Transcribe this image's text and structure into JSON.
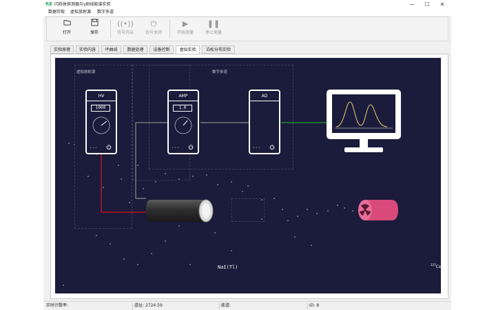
{
  "window": {
    "title": "闪烁体探测器与γ射线能谱实验",
    "app_icon": "RE",
    "controls": {
      "minimize": "—",
      "maximize": "☐",
      "close": "✕"
    }
  },
  "menu": [
    "数据存取",
    "虚拟放射源",
    "数字多道"
  ],
  "toolbar": [
    {
      "label": "打开",
      "icon": "folder-open-icon",
      "enabled": true
    },
    {
      "label": "保存",
      "icon": "save-icon",
      "enabled": true
    },
    {
      "label": "信号开启",
      "icon": "signal-icon",
      "enabled": false
    },
    {
      "label": "信号关闭",
      "icon": "power-icon",
      "enabled": false
    },
    {
      "label": "开始测量",
      "icon": "play-icon",
      "enabled": false
    },
    {
      "label": "停止测量",
      "icon": "pause-icon",
      "enabled": false
    }
  ],
  "tabs": [
    {
      "label": "实验原理",
      "active": false
    },
    {
      "label": "实验内容",
      "active": false
    },
    {
      "label": "坪曲线",
      "active": false
    },
    {
      "label": "数据处理",
      "active": false
    },
    {
      "label": "设备控制",
      "active": false
    },
    {
      "label": "虚拟实验",
      "active": true
    },
    {
      "label": "泊松分布实验",
      "active": false
    }
  ],
  "scene": {
    "source_group_label": "虚拟放射源",
    "mca_group_label": "数字多道",
    "hv": {
      "title": "HV",
      "value": "1000"
    },
    "amp": {
      "title": "AMP",
      "value": "1.0"
    },
    "ad": {
      "title": "AD"
    },
    "detector_label": "NaI(Tl)",
    "source": {
      "isotope_mass": "137",
      "isotope": "Cs"
    },
    "colors": {
      "background": "#1b1b3b",
      "hv_cable": "#c0141e",
      "signal_cable": "#8a8a8a",
      "digital_cable": "#1f8a2c",
      "spectrum": "#d8c56a",
      "source": "#d84a7a"
    }
  },
  "status": [
    {
      "label": "实时计数率:",
      "value": ""
    },
    {
      "label": "道址:",
      "value": "2724.59"
    },
    {
      "label": "能道:",
      "value": ""
    },
    {
      "label": "ID:",
      "value": "8"
    }
  ]
}
